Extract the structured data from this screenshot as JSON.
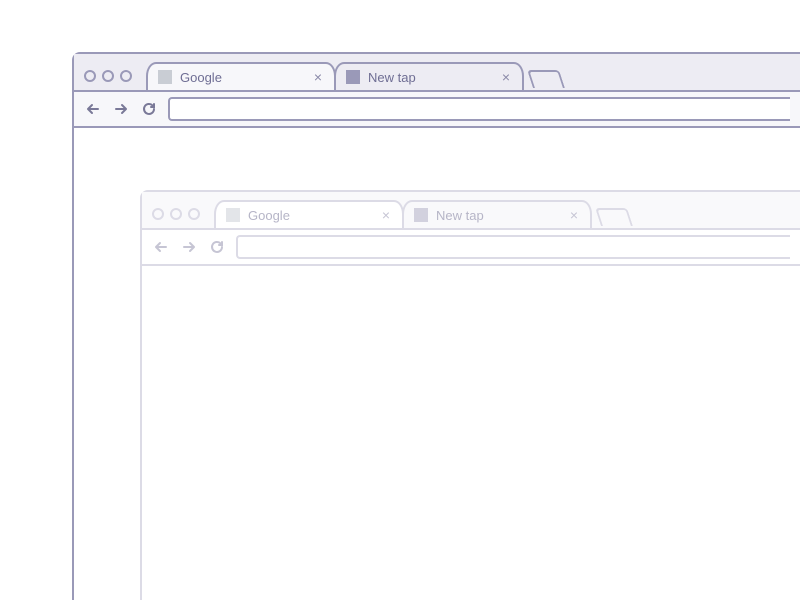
{
  "front_window": {
    "tabs": [
      {
        "label": "Google",
        "active": true
      },
      {
        "label": "New tap",
        "active": false
      }
    ],
    "address": ""
  },
  "back_window": {
    "tabs": [
      {
        "label": "Google",
        "active": true
      },
      {
        "label": "New tap",
        "active": false
      }
    ],
    "address": ""
  }
}
